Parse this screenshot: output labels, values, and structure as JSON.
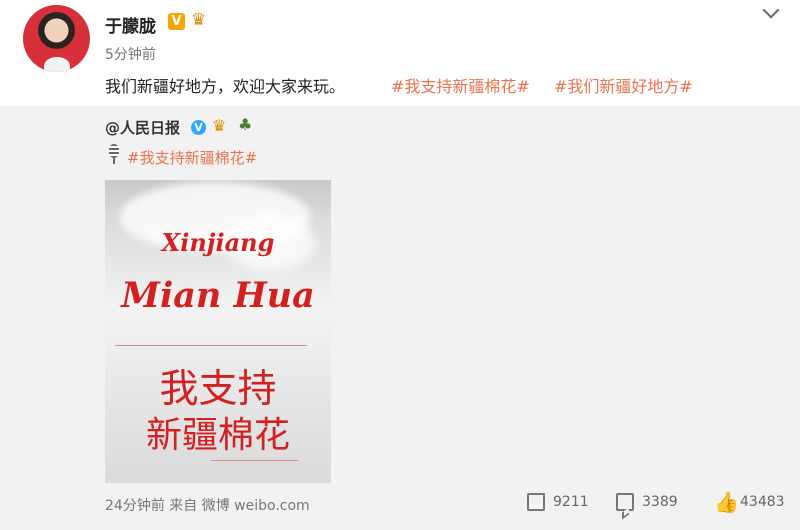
{
  "post": {
    "author": "于朦胧",
    "verified_badge": "V",
    "crown_icon": "crown-icon",
    "timestamp": "5分钟前",
    "text_main": "我们新疆好地方，欢迎大家来玩。",
    "tag1": "#我支持新疆棉花#",
    "tag2": "#我们新疆好地方#"
  },
  "repost": {
    "author": "@人民日报",
    "verified_badge": "V",
    "crown_icon": "crown-icon",
    "tree_icon": "tree-icon",
    "topic": "#我支持新疆棉花#",
    "poster": {
      "line1": "Xinjiang",
      "line2": "Mian Hua",
      "line3": "我支持",
      "line4": "新疆棉花"
    },
    "source": "24分钟前 来自 微博 weibo.com",
    "actions": {
      "shares": "9211",
      "comments": "3389",
      "likes": "43483"
    }
  },
  "colors": {
    "topic_orange": "#eb7350",
    "poster_red": "#d32020",
    "repost_bg": "#f2f2f2"
  }
}
